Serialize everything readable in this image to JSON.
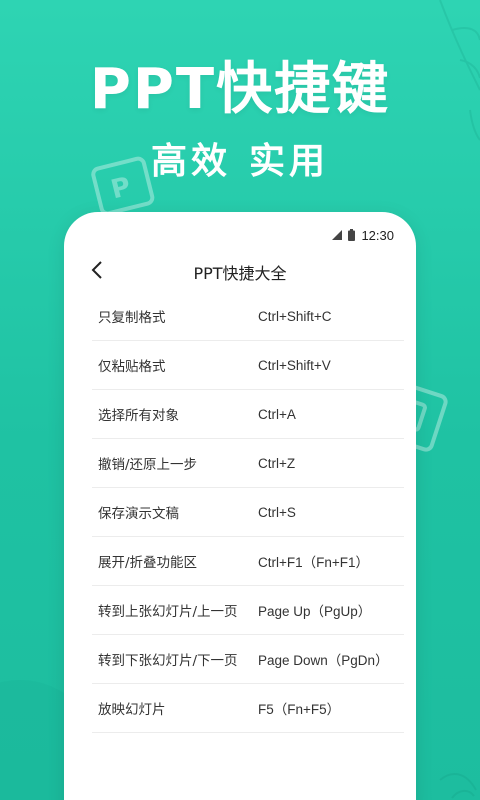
{
  "banner": {
    "title": "PPT快捷键",
    "subtitle_left": "高效",
    "subtitle_right": "实用"
  },
  "phone": {
    "status_time": "12:30",
    "nav_title": "PPT快捷大全",
    "shortcuts": [
      {
        "action": "只复制格式",
        "keys": "Ctrl+Shift+C"
      },
      {
        "action": "仅粘贴格式",
        "keys": "Ctrl+Shift+V"
      },
      {
        "action": "选择所有对象",
        "keys": "Ctrl+A"
      },
      {
        "action": "撤销/还原上一步",
        "keys": "Ctrl+Z"
      },
      {
        "action": "保存演示文稿",
        "keys": "Ctrl+S"
      },
      {
        "action": "展开/折叠功能区",
        "keys": "Ctrl+F1（Fn+F1）"
      },
      {
        "action": "转到上张幻灯片/上一页",
        "keys": "Page Up（PgUp）"
      },
      {
        "action": "转到下张幻灯片/下一页",
        "keys": "Page Down（PgDn）"
      },
      {
        "action": "放映幻灯片",
        "keys": "F5（Fn+F5）"
      }
    ]
  },
  "colors": {
    "background": "#22c8a8",
    "card": "#ffffff",
    "text": "#333333"
  },
  "icons": {
    "back": "chevron-left-icon",
    "signal": "signal-icon",
    "battery": "battery-icon",
    "decor": "ppt-file-icon"
  }
}
